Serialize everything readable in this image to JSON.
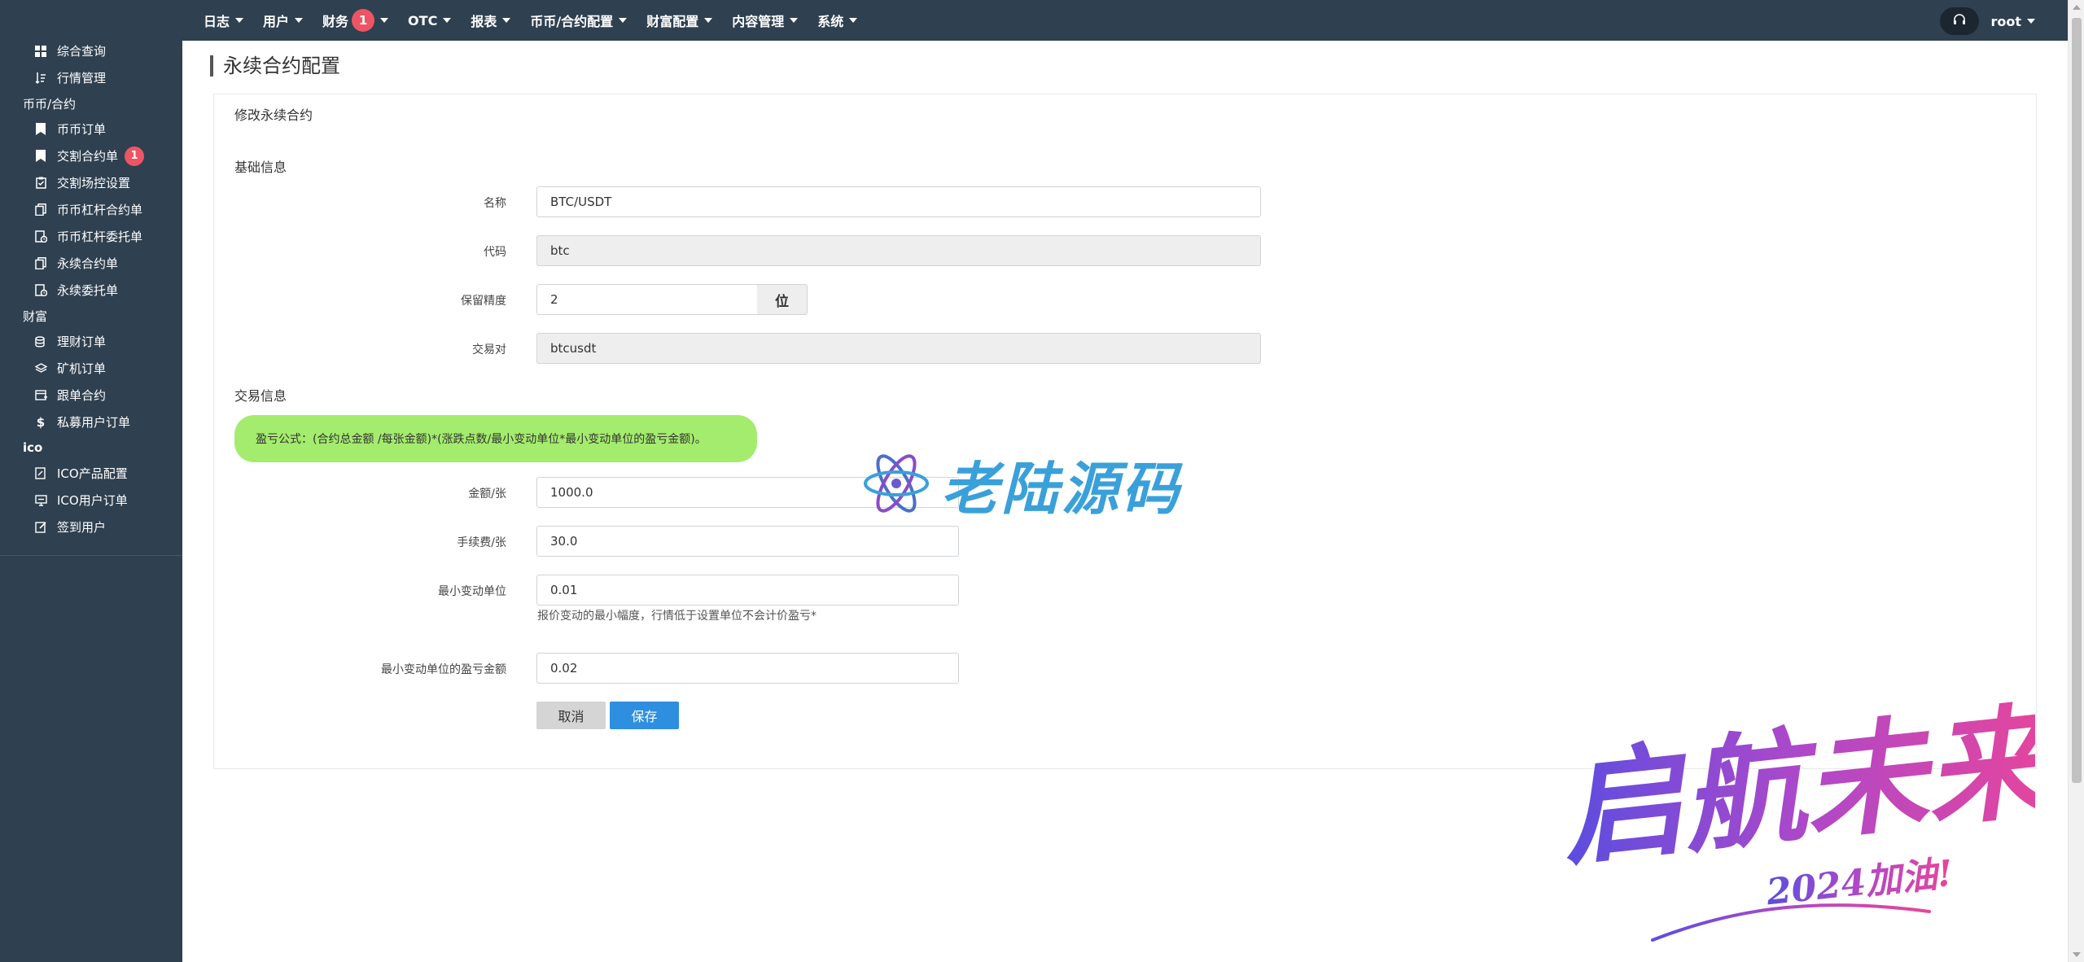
{
  "sidebar": {
    "groups": [
      {
        "title": "",
        "items": [
          {
            "label": "综合查询",
            "icon": "dashboard-icon"
          },
          {
            "label": "行情管理",
            "icon": "sort-icon"
          }
        ]
      },
      {
        "title": "币币/合约",
        "items": [
          {
            "label": "币币订单",
            "icon": "bookmark-icon"
          },
          {
            "label": "交割合约单",
            "icon": "bookmark-icon",
            "badge": "1"
          },
          {
            "label": "交割场控设置",
            "icon": "clipboard-icon"
          },
          {
            "label": "币币杠杆合约单",
            "icon": "copy-icon"
          },
          {
            "label": "币币杠杆委托单",
            "icon": "doc-clock-icon"
          },
          {
            "label": "永续合约单",
            "icon": "copy-icon"
          },
          {
            "label": "永续委托单",
            "icon": "doc-clock-icon"
          }
        ]
      },
      {
        "title": "财富",
        "items": [
          {
            "label": "理财订单",
            "icon": "database-icon"
          },
          {
            "label": "矿机订单",
            "icon": "layers-icon"
          },
          {
            "label": "跟单合约",
            "icon": "calendar-plus-icon"
          },
          {
            "label": "私募用户订单",
            "icon": "dollar-icon"
          }
        ]
      },
      {
        "title": "ico",
        "items": [
          {
            "label": "ICO产品配置",
            "icon": "doc-edit-icon"
          },
          {
            "label": "ICO用户订单",
            "icon": "monitor-icon"
          },
          {
            "label": "签到用户",
            "icon": "edit-icon"
          }
        ]
      }
    ]
  },
  "topnav": {
    "items": [
      {
        "label": "日志"
      },
      {
        "label": "用户"
      },
      {
        "label": "财务",
        "badge": "1"
      },
      {
        "label": "OTC"
      },
      {
        "label": "报表"
      },
      {
        "label": "币币/合约配置"
      },
      {
        "label": "财富配置"
      },
      {
        "label": "内容管理"
      },
      {
        "label": "系统"
      }
    ],
    "user": "root"
  },
  "page": {
    "title": "永续合约配置",
    "panel_heading": "修改永续合约",
    "basic_info_title": "基础信息",
    "trade_info_title": "交易信息"
  },
  "form": {
    "name": {
      "label": "名称",
      "value": "BTC/USDT"
    },
    "code": {
      "label": "代码",
      "value": "btc"
    },
    "precision": {
      "label": "保留精度",
      "value": "2",
      "addon": "位"
    },
    "pair": {
      "label": "交易对",
      "value": "btcusdt"
    },
    "formula_note": "盈亏公式：(合约总金额 /每张金额)*(涨跌点数/最小变动单位*最小变动单位的盈亏金额)。",
    "amount_per_contract": {
      "label": "金额/张",
      "value": "1000.0"
    },
    "fee_per_contract": {
      "label": "手续费/张",
      "value": "30.0"
    },
    "min_tick": {
      "label": "最小变动单位",
      "value": "0.01",
      "help": "报价变动的最小幅度，行情低于设置单位不会计价盈亏*"
    },
    "min_tick_pnl": {
      "label": "最小变动单位的盈亏金额",
      "value": "0.02"
    },
    "cancel_label": "取消",
    "save_label": "保存"
  },
  "watermarks": {
    "laolu": "老陆源码",
    "qihang": "启航未来",
    "qihang_sub": "2024加油!"
  },
  "colors": {
    "sidebar_bg": "#2f4050",
    "badge": "#ed5565",
    "save_button": "#2e8fe0",
    "formula_bg": "#a4ec6d"
  }
}
